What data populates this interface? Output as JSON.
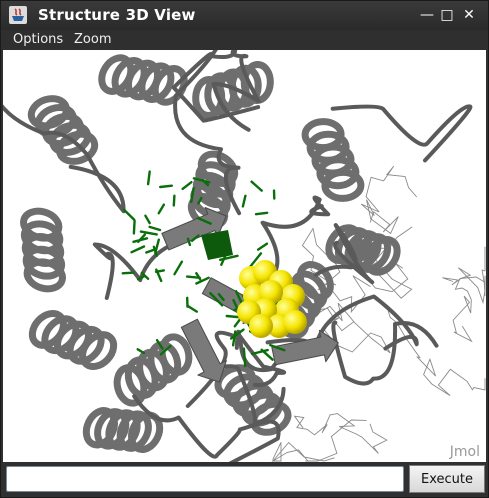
{
  "window": {
    "title": "Structure 3D View",
    "controls": {
      "minimize": "—",
      "maximize": "□",
      "close": "✕"
    }
  },
  "menu": {
    "items": [
      "Options",
      "Zoom"
    ]
  },
  "viewer": {
    "watermark": "Jmol"
  },
  "command": {
    "value": "",
    "execute_label": "Execute"
  },
  "colors": {
    "titlebar": "#2a2a2a",
    "protein_ribbon": "#6e6e6e",
    "ligand_sticks": "#0a6e0a",
    "ligand_spheres": "#f5e400",
    "wireframe": "#8a8a8a"
  }
}
